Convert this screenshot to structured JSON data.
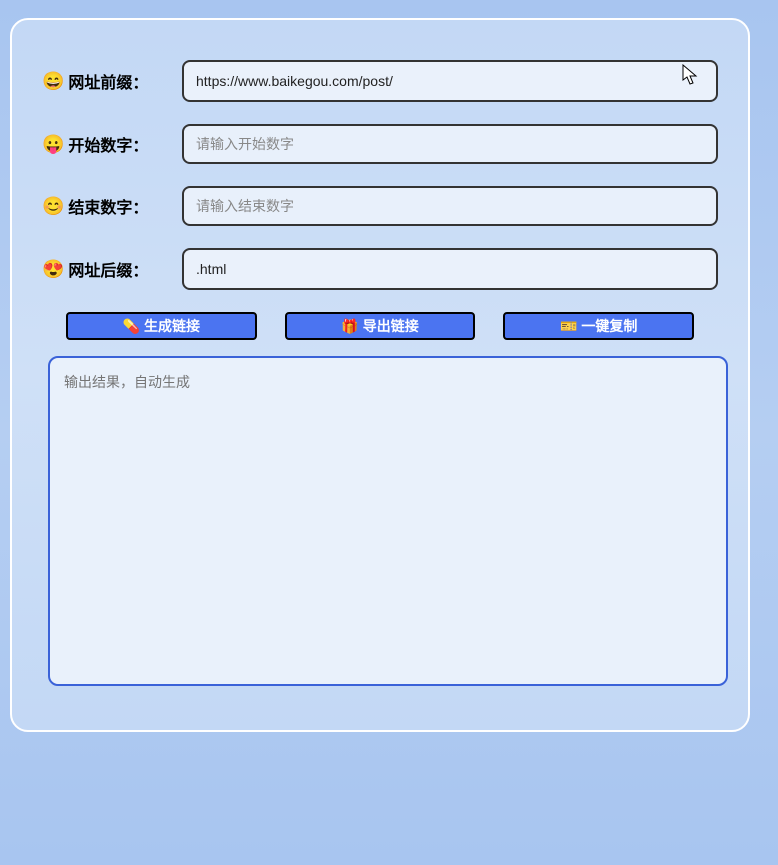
{
  "fields": {
    "prefix": {
      "emoji": "😄",
      "label": "网址前缀：",
      "value": "https://www.baikegou.com/post/",
      "placeholder": ""
    },
    "start": {
      "emoji": "😛",
      "label": "开始数字：",
      "value": "",
      "placeholder": "请输入开始数字"
    },
    "end": {
      "emoji": "😊",
      "label": "结束数字：",
      "value": "",
      "placeholder": "请输入结束数字"
    },
    "suffix": {
      "emoji": "😍",
      "label": "网址后缀：",
      "value": ".html",
      "placeholder": ""
    }
  },
  "buttons": {
    "generate": {
      "icon": "💊",
      "label": "生成链接"
    },
    "export": {
      "icon": "🎁",
      "label": "导出链接"
    },
    "copy": {
      "icon": "🎫",
      "label": "一键复制"
    }
  },
  "output": {
    "placeholder": "输出结果，自动生成"
  }
}
